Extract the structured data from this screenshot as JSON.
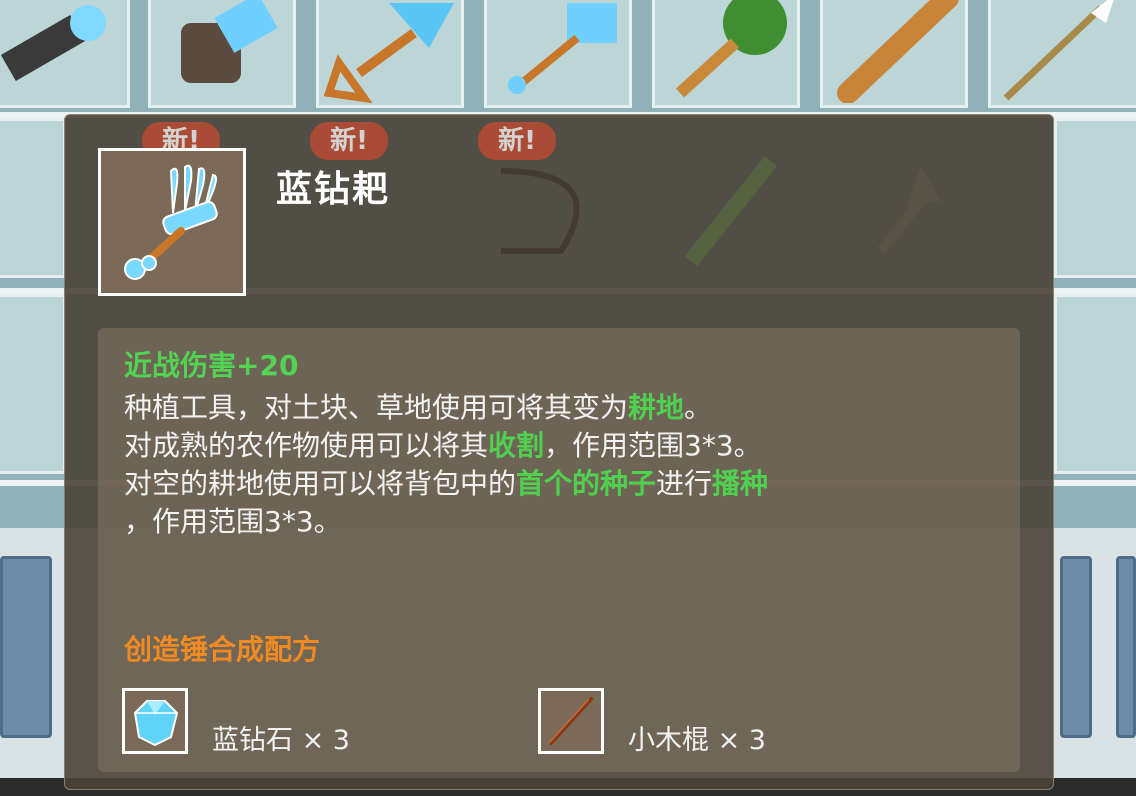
{
  "background": {
    "new_badges": [
      "新!",
      "新!",
      "新!"
    ]
  },
  "tooltip": {
    "item_name": "蓝钻耙",
    "stat": "近战伤害+20",
    "description": {
      "line1_a": "种植工具，对土块、草地使用可将其变为",
      "line1_hl": "耕地",
      "line1_b": "。",
      "line2_a": "对成熟的农作物使用可以将其",
      "line2_hl": "收割",
      "line2_b": "，作用范围3*3。",
      "line3_a": "对空的耕地使用可以将背包中的",
      "line3_hl": "首个的种子",
      "line3_b": "进行",
      "line3_hl2": "播种",
      "line4": "，作用范围3*3。"
    },
    "recipe_title": "创造锤合成配方",
    "ingredients": [
      {
        "name": "蓝钻石 × 3",
        "icon": "blue-diamond-icon"
      },
      {
        "name": "小木棍 × 3",
        "icon": "wooden-stick-icon"
      }
    ]
  },
  "colors": {
    "highlight_green": "#4fd04f",
    "recipe_orange": "#f08a22",
    "panel_bg": "#4a4238"
  }
}
